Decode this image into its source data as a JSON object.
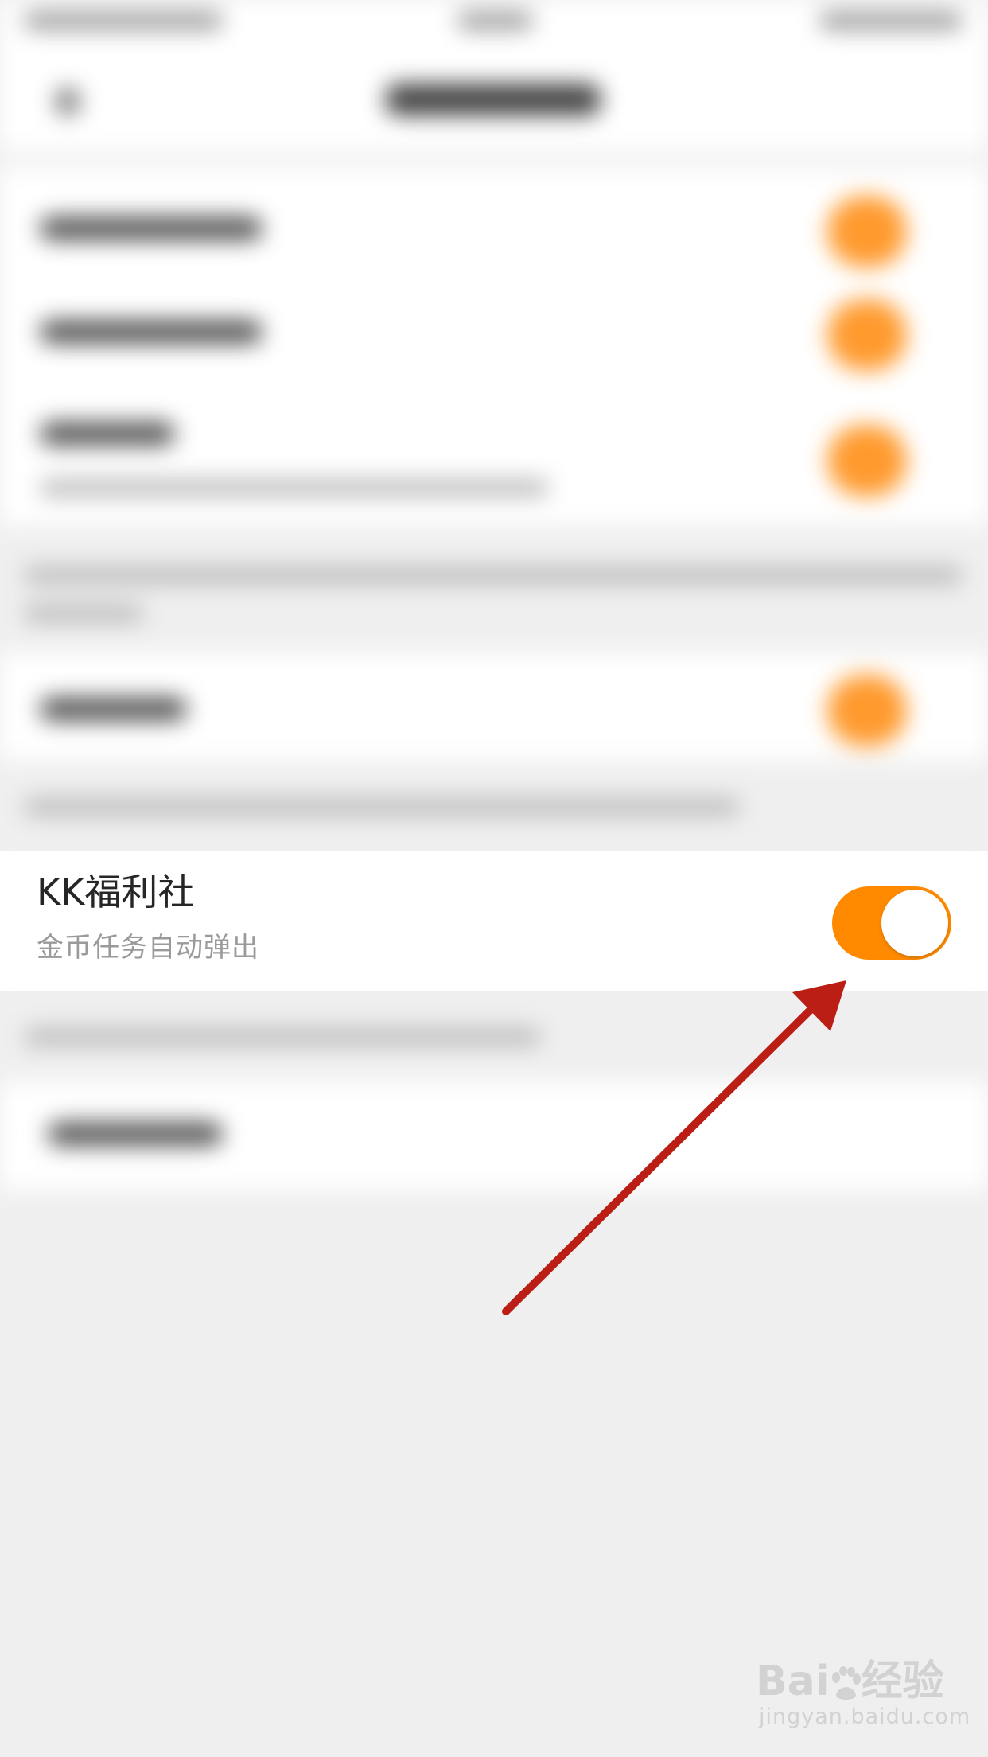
{
  "setting": {
    "title": "KK福利社",
    "subtitle": "金币任务自动弹出",
    "enabled": true
  },
  "watermark": {
    "brand_left": "Bai",
    "brand_right": "经验",
    "url": "jingyan.baidu.com"
  },
  "colors": {
    "toggle_on": "#ff8a00",
    "arrow": "#bb1e14",
    "background": "#efefef"
  },
  "icons": {
    "annotation": "red-arrow-icon",
    "watermark": "baidu-paw-icon"
  }
}
